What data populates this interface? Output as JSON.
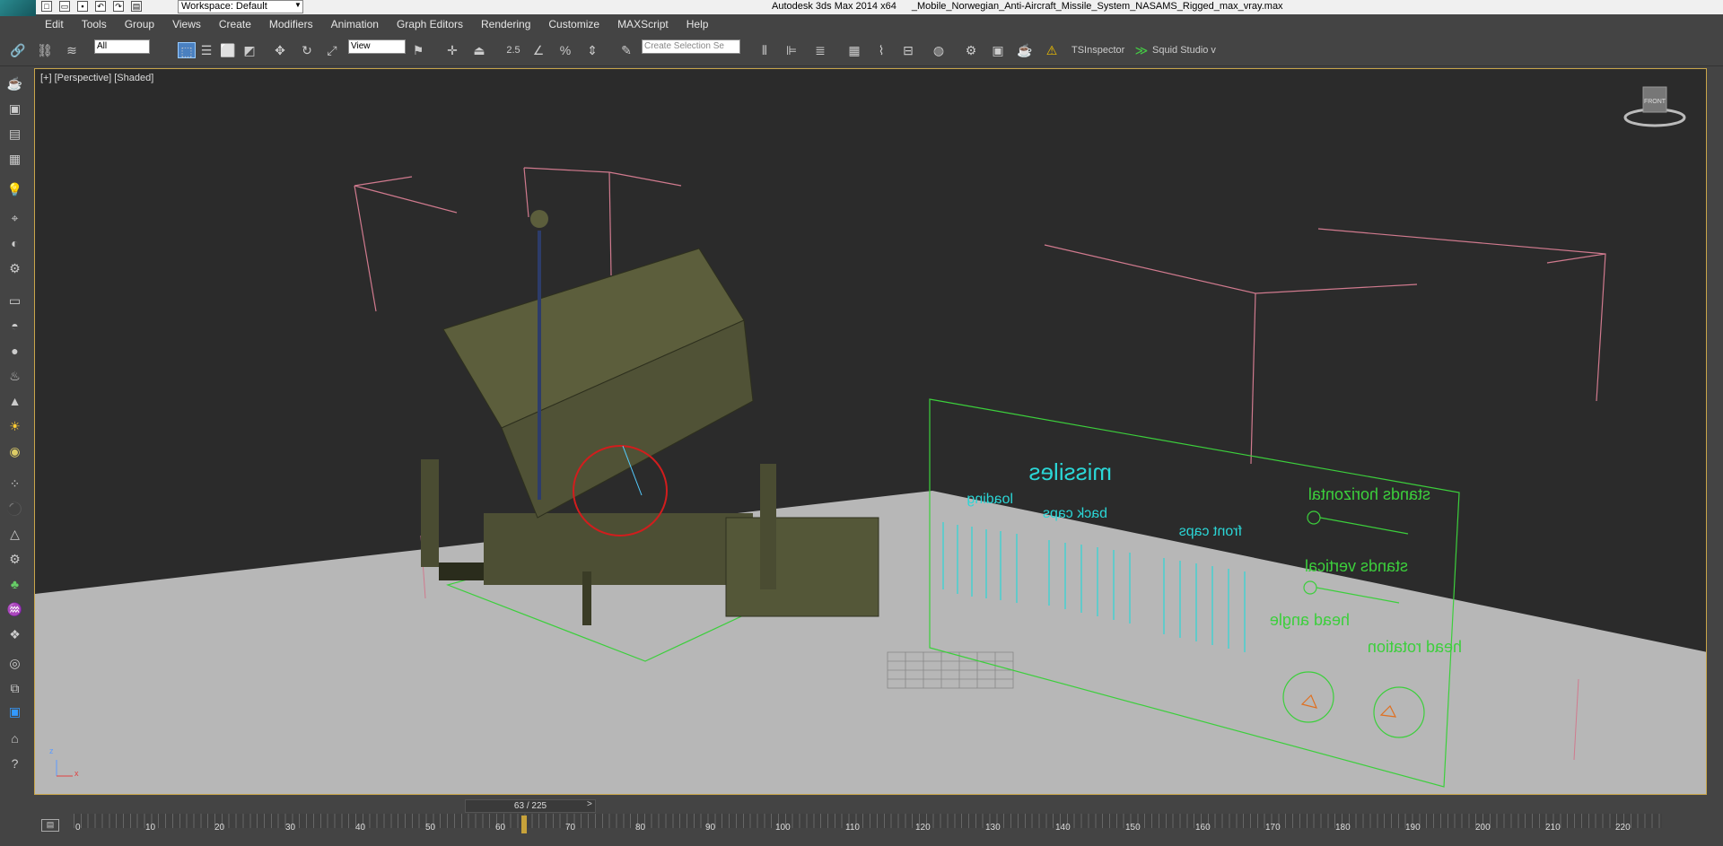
{
  "titlebar": {
    "workspace": "Workspace: Default",
    "app": "Autodesk 3ds Max  2014 x64",
    "file": "_Mobile_Norwegian_Anti-Aircraft_Missile_System_NASAMS_Rigged_max_vray.max"
  },
  "menu": [
    "Edit",
    "Tools",
    "Group",
    "Views",
    "Create",
    "Modifiers",
    "Animation",
    "Graph Editors",
    "Rendering",
    "Customize",
    "MAXScript",
    "Help"
  ],
  "toolbar": {
    "filter_value": "All",
    "refcoord_value": "View",
    "snap_value": "2.5",
    "selection_set_placeholder": "Create Selection Se",
    "tsinspector": "TSInspector",
    "squid": "Squid Studio v"
  },
  "viewport": {
    "label": "[+] [Perspective] [Shaded]",
    "viewcube": "FRONT",
    "axis_x": "x",
    "axis_z": "z"
  },
  "control_panel": {
    "title": "missiles",
    "group_loading": "loading",
    "group_back_caps": "back caps",
    "group_front_caps": "front caps",
    "stands_horizontal": "stands horizontal",
    "stands_vertical": "stands vertical",
    "head_angle": "head angle",
    "head_rotation": "head rotation"
  },
  "timeline": {
    "frame_display": "63 / 225",
    "prev": "<",
    "next": ">",
    "ticks": [
      "0",
      "10",
      "20",
      "30",
      "40",
      "50",
      "60",
      "70",
      "80",
      "90",
      "100",
      "110",
      "120",
      "130",
      "140",
      "150",
      "160",
      "170",
      "180",
      "190",
      "200",
      "210",
      "220"
    ]
  }
}
